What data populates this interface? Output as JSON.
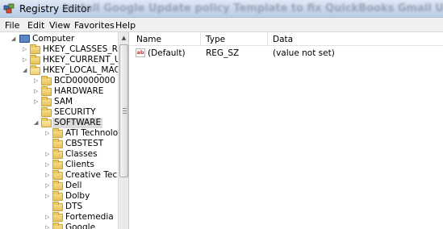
{
  "window": {
    "title": "Registry Editor",
    "blurred_title": "Install Google Update policy Template to fix QuickBooks Gmail Update"
  },
  "menu": [
    "File",
    "Edit",
    "View",
    "Favorites",
    "Help"
  ],
  "tree": {
    "root": "Computer",
    "hives": [
      "HKEY_CLASSES_ROOT",
      "HKEY_CURRENT_USER",
      "HKEY_LOCAL_MACHINE"
    ],
    "hklm_children": [
      "BCD00000000",
      "HARDWARE",
      "SAM",
      "SECURITY",
      "SOFTWARE"
    ],
    "software_children": [
      "ATI Technologies",
      "CBSTEST",
      "Classes",
      "Clients",
      "Creative Tech",
      "Dell",
      "Dolby",
      "DTS",
      "Fortemedia",
      "Google"
    ],
    "selected": "SOFTWARE"
  },
  "list": {
    "columns": [
      "Name",
      "Type",
      "Data"
    ],
    "rows": [
      {
        "name": "(Default)",
        "type": "REG_SZ",
        "data": "(value not set)"
      }
    ]
  }
}
